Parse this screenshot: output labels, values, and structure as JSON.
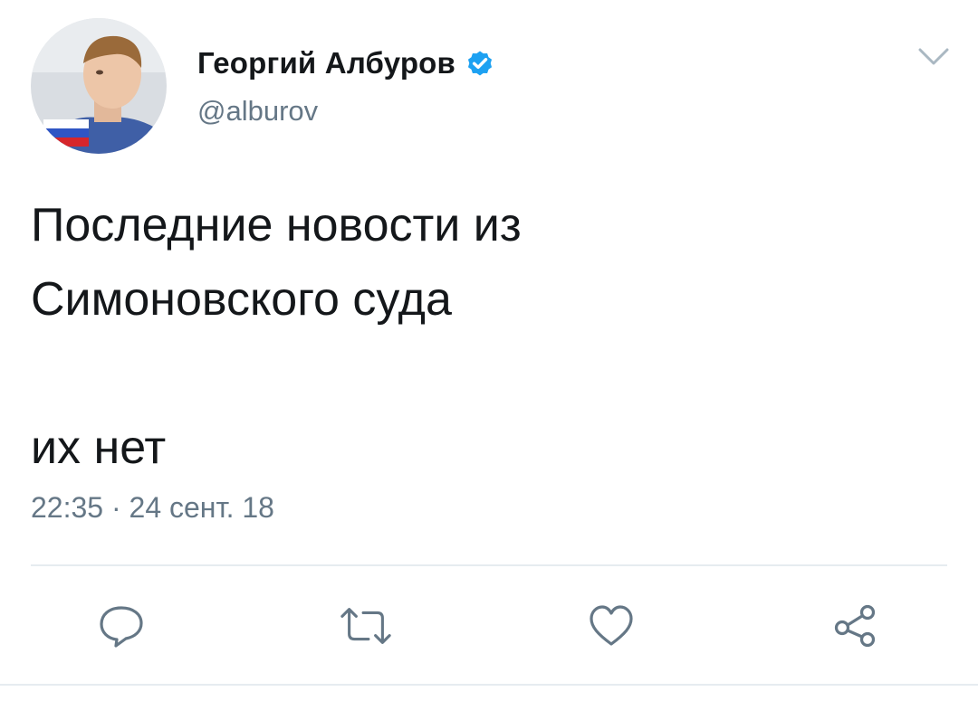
{
  "author": {
    "display_name": "Георгий Албуров",
    "handle": "@alburov",
    "verified": true
  },
  "tweet": {
    "lines": [
      "Последние новости из",
      "Симоновского суда",
      "",
      "их нет"
    ],
    "timestamp": "22:35 · 24 сент. 18"
  },
  "icons": {
    "avatar": "avatar",
    "verified": "verified-badge-icon",
    "menu": "chevron-down-icon",
    "actions": [
      "reply-icon",
      "retweet-icon",
      "like-icon",
      "share-icon"
    ]
  },
  "colors": {
    "text": "#14171a",
    "secondary": "#657786",
    "accent": "#1da1f2",
    "divider": "#e6ecf0"
  }
}
